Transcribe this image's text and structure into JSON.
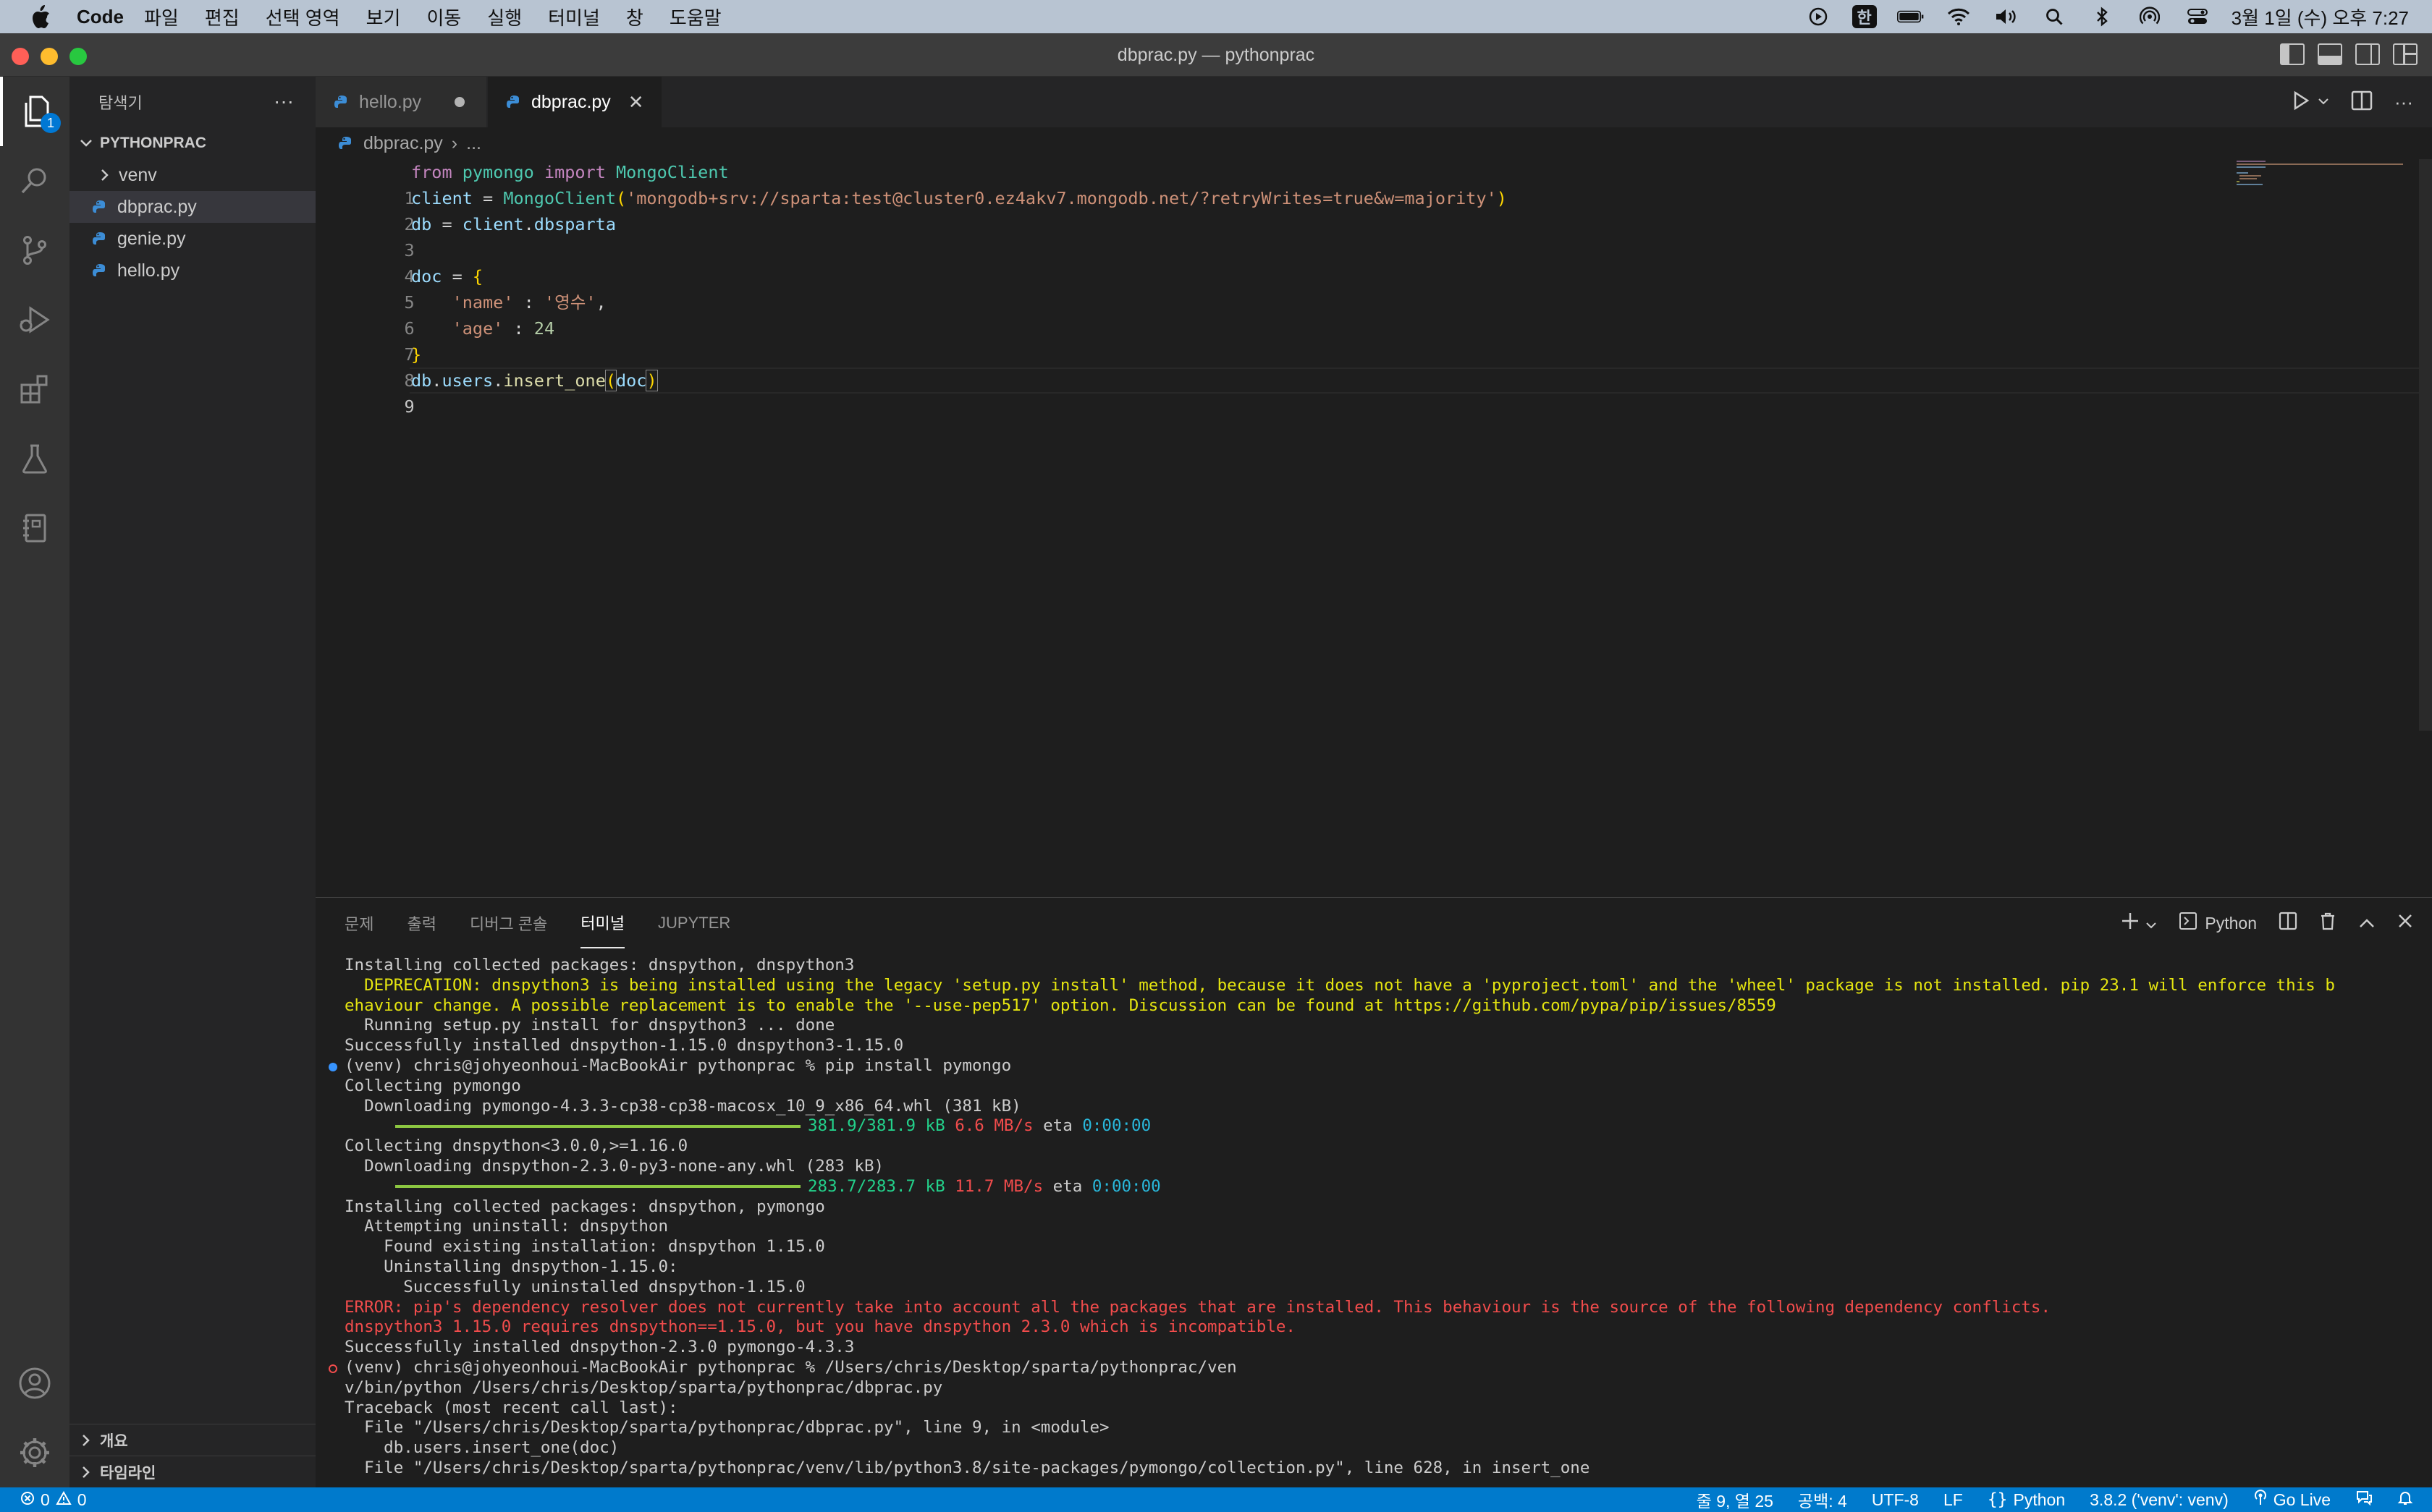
{
  "menubar": {
    "app_name": "Code",
    "items": [
      "파일",
      "편집",
      "선택 영역",
      "보기",
      "이동",
      "실행",
      "터미널",
      "창",
      "도움말"
    ],
    "ime": "한",
    "clock": "3월 1일 (수) 오후 7:27"
  },
  "window": {
    "title": "dbprac.py — pythonprac"
  },
  "activity": {
    "explorer_badge": "1"
  },
  "sidebar": {
    "title": "탐색기",
    "more": "···",
    "project": "PYTHONPRAC",
    "folder": "venv",
    "files": [
      "dbprac.py",
      "genie.py",
      "hello.py"
    ],
    "outline": "개요",
    "timeline": "타임라인"
  },
  "tabs": [
    {
      "label": "hello.py",
      "state": "modified"
    },
    {
      "label": "dbprac.py",
      "state": "active"
    }
  ],
  "breadcrumb": {
    "file": "dbprac.py",
    "rest": "..."
  },
  "editor": {
    "line_numbers": [
      "1",
      "2",
      "3",
      "4",
      "5",
      "6",
      "7",
      "8",
      "9"
    ],
    "current_line": 9,
    "code": {
      "l1_from": "from",
      "l1_mod": "pymongo",
      "l1_import": "import",
      "l1_cls": "MongoClient",
      "l2_var": "client",
      "l2_eq": " = ",
      "l2_cls": "MongoClient",
      "l2_open": "(",
      "l2_str": "'mongodb+srv://sparta:test@cluster0.ez4akv7.mongodb.net/?retryWrites=true&w=majority'",
      "l2_close": ")",
      "l3_var": "db",
      "l3_eq": " = ",
      "l3_obj": "client",
      "l3_dot": ".",
      "l3_attr": "dbsparta",
      "l5_var": "doc",
      "l5_eq": " = ",
      "l5_brace": "{",
      "l6_indent": "    ",
      "l6_key": "'name'",
      "l6_colon": " : ",
      "l6_val": "'영수'",
      "l6_comma": ",",
      "l7_indent": "    ",
      "l7_key": "'age'",
      "l7_colon": " : ",
      "l7_val": "24",
      "l8_brace": "}",
      "l9_db": "db",
      "l9_d1": ".",
      "l9_users": "users",
      "l9_d2": ".",
      "l9_fn": "insert_one",
      "l9_open": "(",
      "l9_arg": "doc",
      "l9_close": ")"
    }
  },
  "panel": {
    "tabs": [
      "문제",
      "출력",
      "디버그 콘솔",
      "터미널",
      "JUPYTER"
    ],
    "shell": "Python"
  },
  "terminal": {
    "l1": "Installing collected packages: dnspython, dnspython3",
    "l2": "  DEPRECATION: dnspython3 is being installed using the legacy 'setup.py install' method, because it does not have a 'pyproject.toml' and the 'wheel' package is not installed. pip 23.1 will enforce this b",
    "l3": "ehaviour change. A possible replacement is to enable the '--use-pep517' option. Discussion can be found at https://github.com/pypa/pip/issues/8559",
    "l4": "  Running setup.py install for dnspython3 ... done",
    "l5": "Successfully installed dnspython-1.15.0 dnspython3-1.15.0",
    "l6": "(venv) chris@johyeonhoui-MacBookAir pythonprac % pip install pymongo",
    "l7": "Collecting pymongo",
    "l8": "  Downloading pymongo-4.3.3-cp38-cp38-macosx_10_9_x86_64.whl (381 kB)",
    "l9_size": "381.9/381.9 kB",
    "l9_speed": "6.6 MB/s",
    "l9_eta_label": " eta ",
    "l9_eta": "0:00:00",
    "l10": "Collecting dnspython<3.0.0,>=1.16.0",
    "l11": "  Downloading dnspython-2.3.0-py3-none-any.whl (283 kB)",
    "l12_size": "283.7/283.7 kB",
    "l12_speed": "11.7 MB/s",
    "l12_eta_label": " eta ",
    "l12_eta": "0:00:00",
    "l13": "Installing collected packages: dnspython, pymongo",
    "l14": "  Attempting uninstall: dnspython",
    "l15": "    Found existing installation: dnspython 1.15.0",
    "l16": "    Uninstalling dnspython-1.15.0:",
    "l17": "      Successfully uninstalled dnspython-1.15.0",
    "l18": "ERROR: pip's dependency resolver does not currently take into account all the packages that are installed. This behaviour is the source of the following dependency conflicts.",
    "l19": "dnspython3 1.15.0 requires dnspython==1.15.0, but you have dnspython 2.3.0 which is incompatible.",
    "l20": "Successfully installed dnspython-2.3.0 pymongo-4.3.3",
    "l21": "(venv) chris@johyeonhoui-MacBookAir pythonprac % /Users/chris/Desktop/sparta/pythonprac/ven",
    "l22": "v/bin/python /Users/chris/Desktop/sparta/pythonprac/dbprac.py",
    "l23": "Traceback (most recent call last):",
    "l24": "  File \"/Users/chris/Desktop/sparta/pythonprac/dbprac.py\", line 9, in <module>",
    "l25": "    db.users.insert_one(doc)",
    "l26": "  File \"/Users/chris/Desktop/sparta/pythonprac/venv/lib/python3.8/site-packages/pymongo/collection.py\", line 628, in insert_one"
  },
  "statusbar": {
    "errors": "0",
    "warnings": "0",
    "position": "줄 9, 열 25",
    "spaces": "공백: 4",
    "encoding": "UTF-8",
    "eol": "LF",
    "language": "Python",
    "interpreter": "3.8.2 ('venv': venv)",
    "golive": "Go Live"
  },
  "colors": {
    "accent": "#007acc",
    "keyword": "#c586c0",
    "string": "#ce9178",
    "class": "#4ec9b0",
    "error": "#f14c4c",
    "warning": "#e5e510",
    "progress": "#8cc641"
  },
  "icons": [
    "apple-icon",
    "explorer-icon",
    "search-icon",
    "source-control-icon",
    "run-debug-icon",
    "extensions-icon",
    "testing-icon",
    "notebook-icon",
    "account-icon",
    "gear-icon",
    "python-file-icon",
    "run-icon",
    "split-editor-icon",
    "plus-icon",
    "trash-icon",
    "maximize-icon",
    "close-icon"
  ]
}
